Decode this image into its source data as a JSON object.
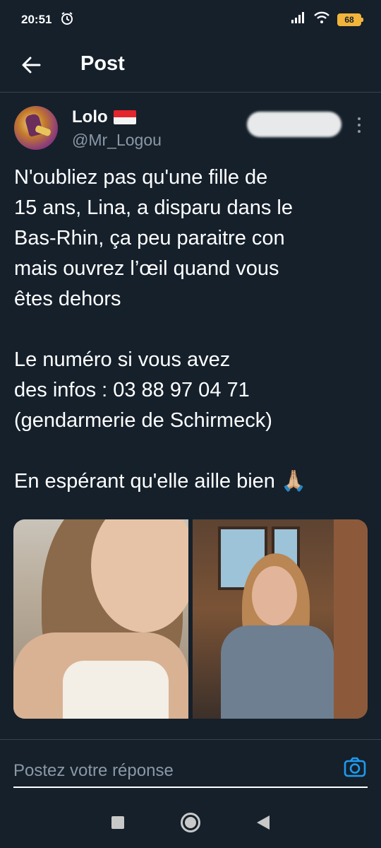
{
  "status_bar": {
    "time": "20:51",
    "battery": "68",
    "icons": [
      "alarm-icon",
      "signal-icon",
      "wifi-icon",
      "battery-icon"
    ]
  },
  "header": {
    "title": "Post",
    "back_icon": "arrow-left-icon"
  },
  "tweet": {
    "display_name": "Lolo",
    "flag": "🇲🇨",
    "handle": "@Mr_Logou",
    "paragraphs": [
      "N'oubliez pas qu'une fille de\n15 ans, Lina, a disparu dans le\nBas-Rhin, ça peu paraitre con\nmais ouvrez l’œil quand vous\nêtes dehors",
      "Le numéro si vous avez\ndes infos : 03 88 97 04 71\n(gendarmerie de Schirmeck)",
      "En espérant qu'elle aille bien 🙏🏼"
    ],
    "media_count": 2
  },
  "reply": {
    "placeholder": "Postez votre réponse",
    "camera_icon": "camera-icon"
  },
  "colors": {
    "background": "#15202b",
    "divider": "#38444d",
    "secondary_text": "#8b98a5",
    "accent": "#1d9bf0"
  }
}
